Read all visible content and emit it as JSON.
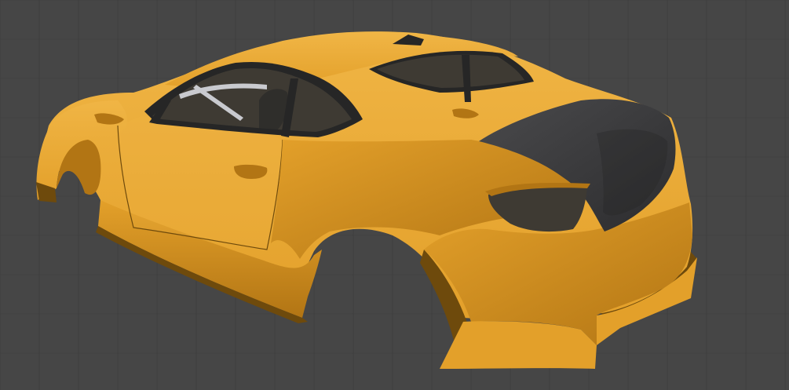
{
  "viewport": {
    "background_color": "#464646",
    "grid_color": "#3c3c3c",
    "grid_visible": true
  },
  "model": {
    "subject": "car-body-shell",
    "body_color": "#E3A02A",
    "body_shadow_color": "#B27514",
    "body_dark_shadow_color": "#6E4A0C",
    "body_highlight_color": "#F0B545",
    "trunk_lid_color": "#3C3C3E",
    "frame_color": "#262626",
    "interior_color": "#3E3A33",
    "roll_cage_color": "#C9CACF"
  }
}
